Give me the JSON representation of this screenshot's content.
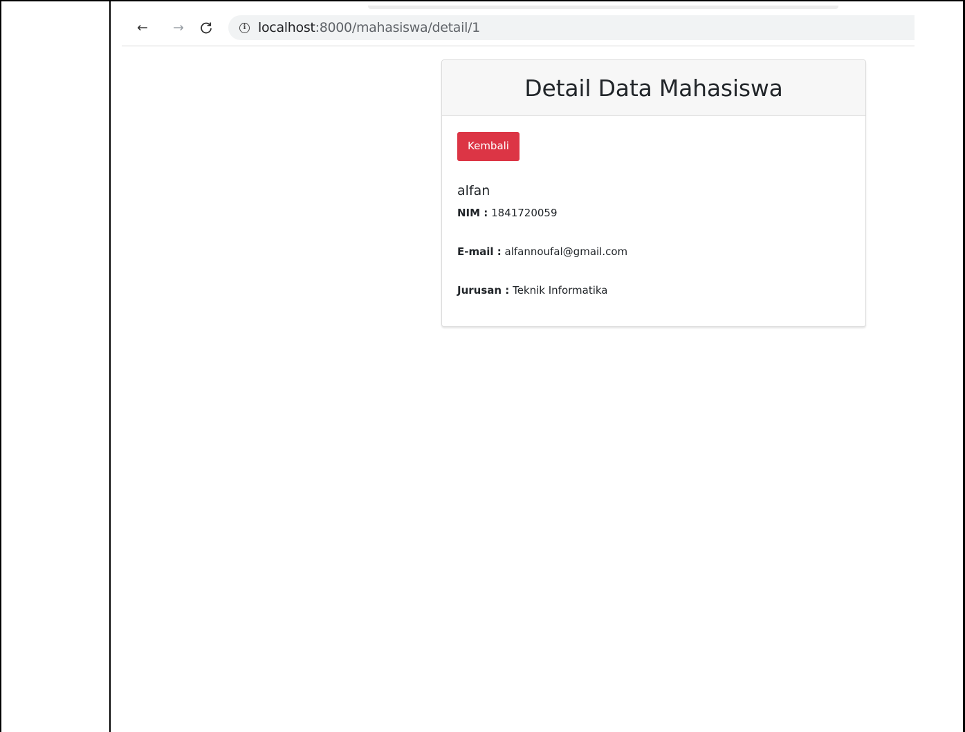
{
  "browser": {
    "nav": {
      "back_glyph": "←",
      "forward_glyph": "→",
      "reload_glyph": "C"
    },
    "address_bar": {
      "host": "localhost",
      "path": ":8000/mahasiswa/detail/1",
      "info_icon": "ⓘ"
    }
  },
  "card": {
    "title": "Detail Data Mahasiswa",
    "back_button": "Kembali",
    "student_name": "alfan",
    "fields": [
      {
        "label": "NIM :",
        "value": "1841720059"
      },
      {
        "label": "E-mail :",
        "value": "alfannoufal@gmail.com"
      },
      {
        "label": "Jurusan :",
        "value": "Teknik Informatika"
      }
    ]
  },
  "colors": {
    "danger_button": "#dc3545",
    "card_header_bg": "#f7f7f7",
    "omnibox_bg": "#f1f3f4"
  },
  "icons": [
    "back-arrow-icon",
    "forward-arrow-icon",
    "reload-icon",
    "info-icon"
  ]
}
